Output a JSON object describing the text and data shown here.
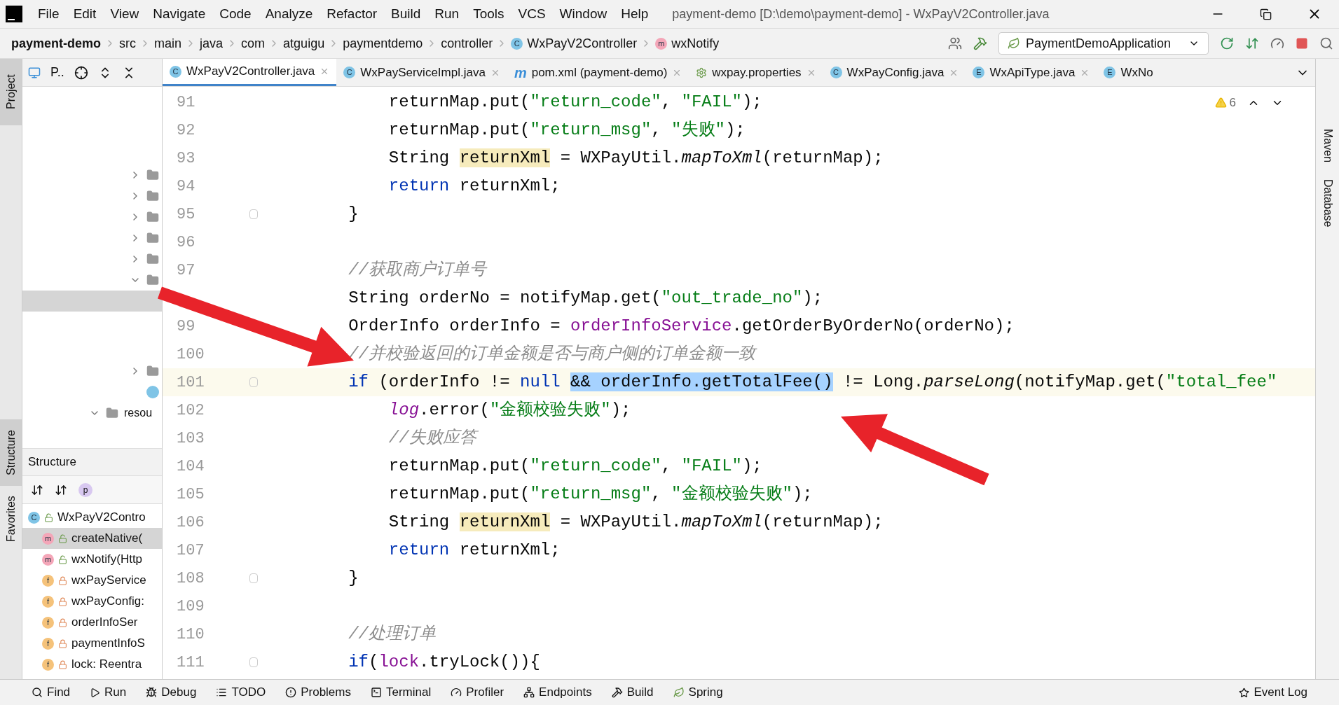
{
  "menu": [
    "File",
    "Edit",
    "View",
    "Navigate",
    "Code",
    "Analyze",
    "Refactor",
    "Build",
    "Run",
    "Tools",
    "VCS",
    "Window",
    "Help"
  ],
  "window": {
    "title": "payment-demo [D:\\demo\\payment-demo] - WxPayV2Controller.java"
  },
  "breadcrumbs": [
    {
      "label": "payment-demo",
      "kind": "project"
    },
    {
      "label": "src",
      "kind": "folder"
    },
    {
      "label": "main",
      "kind": "folder"
    },
    {
      "label": "java",
      "kind": "folder"
    },
    {
      "label": "com",
      "kind": "folder"
    },
    {
      "label": "atguigu",
      "kind": "folder"
    },
    {
      "label": "paymentdemo",
      "kind": "folder"
    },
    {
      "label": "controller",
      "kind": "folder"
    },
    {
      "label": "WxPayV2Controller",
      "kind": "class",
      "badge": "C"
    },
    {
      "label": "wxNotify",
      "kind": "method",
      "badge": "m"
    }
  ],
  "run_config": {
    "label": "PaymentDemoApplication"
  },
  "project_panel": {
    "title": "P..",
    "tree": [
      {
        "kind": "folder",
        "expanded": false,
        "selected": false
      },
      {
        "kind": "folder",
        "expanded": false,
        "selected": false
      },
      {
        "kind": "folder",
        "expanded": false,
        "selected": false
      },
      {
        "kind": "folder",
        "expanded": false,
        "selected": false
      },
      {
        "kind": "folder",
        "expanded": false,
        "selected": false
      },
      {
        "kind": "folder",
        "expanded": true,
        "selected": false
      },
      {
        "kind": "blank",
        "selected": true
      },
      {
        "kind": "folder",
        "expanded": false,
        "selected": false
      },
      {
        "kind": "class",
        "selected": false
      },
      {
        "kind": "folder",
        "expanded": true,
        "selected": false,
        "label": "resou"
      }
    ]
  },
  "structure_panel": {
    "title": "Structure",
    "filter_badge": "p",
    "items": [
      {
        "badge": "C",
        "label": "WxPayV2Contro",
        "kind": "class",
        "selected": false
      },
      {
        "badge": "m",
        "label": "createNative(",
        "kind": "method",
        "selected": true
      },
      {
        "badge": "m",
        "label": "wxNotify(Http",
        "kind": "method",
        "selected": false
      },
      {
        "badge": "f",
        "label": "wxPayService",
        "kind": "field",
        "selected": false
      },
      {
        "badge": "f",
        "label": "wxPayConfig:",
        "kind": "field",
        "selected": false
      },
      {
        "badge": "f",
        "label": "orderInfoSer",
        "kind": "field",
        "selected": false
      },
      {
        "badge": "f",
        "label": "paymentInfoS",
        "kind": "field",
        "selected": false
      },
      {
        "badge": "f",
        "label": "lock: Reentra",
        "kind": "field",
        "selected": false
      }
    ]
  },
  "side_tabs_left": [
    {
      "label": "Project",
      "selected": true
    },
    {
      "label": "Structure",
      "selected": true
    },
    {
      "label": "Favorites",
      "selected": false
    }
  ],
  "side_tabs_right": [
    "Maven",
    "Database"
  ],
  "tabs": [
    {
      "label": "WxPayV2Controller.java",
      "badge": "C",
      "kind": "class",
      "selected": true
    },
    {
      "label": "WxPayServiceImpl.java",
      "badge": "C",
      "kind": "class",
      "selected": false
    },
    {
      "label": "pom.xml (payment-demo)",
      "badge": "m",
      "kind": "maven",
      "selected": false
    },
    {
      "label": "wxpay.properties",
      "kind": "properties",
      "selected": false
    },
    {
      "label": "WxPayConfig.java",
      "badge": "C",
      "kind": "class",
      "selected": false
    },
    {
      "label": "WxApiType.java",
      "badge": "E",
      "kind": "enum",
      "selected": false
    },
    {
      "label": "WxNo",
      "badge": "E",
      "kind": "enum",
      "selected": false
    }
  ],
  "inspections": {
    "warnings": "6"
  },
  "code": [
    {
      "number": "91",
      "tokens": [
        {
          "kind": "plain",
          "text": "            returnMap.put("
        },
        {
          "kind": "string",
          "text": "\"return_code\""
        },
        {
          "kind": "plain",
          "text": ", "
        },
        {
          "kind": "string",
          "text": "\"FAIL\""
        },
        {
          "kind": "plain",
          "text": ");"
        }
      ]
    },
    {
      "number": "92",
      "tokens": [
        {
          "kind": "plain",
          "text": "            returnMap.put("
        },
        {
          "kind": "string",
          "text": "\"return_msg\""
        },
        {
          "kind": "plain",
          "text": ", "
        },
        {
          "kind": "string",
          "text": "\"失败\""
        },
        {
          "kind": "plain",
          "text": ");"
        }
      ]
    },
    {
      "number": "93",
      "tokens": [
        {
          "kind": "plain",
          "text": "            String "
        },
        {
          "kind": "usage",
          "text": "returnXml"
        },
        {
          "kind": "plain",
          "text": " = WXPayUtil."
        },
        {
          "kind": "static",
          "text": "mapToXml"
        },
        {
          "kind": "plain",
          "text": "(returnMap);"
        }
      ]
    },
    {
      "number": "94",
      "tokens": [
        {
          "kind": "keyword",
          "text": "            return"
        },
        {
          "kind": "plain",
          "text": " returnXml;"
        }
      ]
    },
    {
      "number": "95",
      "fold": true,
      "tokens": [
        {
          "kind": "plain",
          "text": "        }"
        }
      ]
    },
    {
      "number": "96"
    },
    {
      "number": "97",
      "tokens": [
        {
          "kind": "comment",
          "text": "        //获取商户订单号"
        }
      ]
    },
    {
      "tokens": [
        {
          "kind": "plain",
          "text": "        String orderNo = notifyMap.get("
        },
        {
          "kind": "string",
          "text": "\"out_trade_no\""
        },
        {
          "kind": "plain",
          "text": ");"
        }
      ]
    },
    {
      "number": "99",
      "tokens": [
        {
          "kind": "plain",
          "text": "        OrderInfo orderInfo = "
        },
        {
          "kind": "field",
          "text": "orderInfoService"
        },
        {
          "kind": "plain",
          "text": ".getOrderByOrderNo(orderNo);"
        }
      ]
    },
    {
      "number": "100",
      "tokens": [
        {
          "kind": "comment",
          "text": "        //并校验返回的订单金额是否与商户侧的订单金额一致"
        }
      ]
    },
    {
      "number": "101",
      "fold": true,
      "current": true,
      "tokens": [
        {
          "kind": "keyword",
          "text": "        if"
        },
        {
          "kind": "plain",
          "text": " (orderInfo != "
        },
        {
          "kind": "keyword",
          "text": "null "
        },
        {
          "kind": "selection",
          "text": "&& orderInfo.getTotalFee()"
        },
        {
          "kind": "plain",
          "text": " != Long."
        },
        {
          "kind": "static",
          "text": "parseLong"
        },
        {
          "kind": "plain",
          "text": "(notifyMap.get("
        },
        {
          "kind": "string",
          "text": "\"total_fee\""
        }
      ]
    },
    {
      "number": "102",
      "tokens": [
        {
          "kind": "staticfield",
          "text": "            log"
        },
        {
          "kind": "plain",
          "text": ".error("
        },
        {
          "kind": "string",
          "text": "\"金额校验失败\""
        },
        {
          "kind": "plain",
          "text": ");"
        }
      ]
    },
    {
      "number": "103",
      "tokens": [
        {
          "kind": "comment",
          "text": "            //失败应答"
        }
      ]
    },
    {
      "number": "104",
      "tokens": [
        {
          "kind": "plain",
          "text": "            returnMap.put("
        },
        {
          "kind": "string",
          "text": "\"return_code\""
        },
        {
          "kind": "plain",
          "text": ", "
        },
        {
          "kind": "string",
          "text": "\"FAIL\""
        },
        {
          "kind": "plain",
          "text": ");"
        }
      ]
    },
    {
      "number": "105",
      "tokens": [
        {
          "kind": "plain",
          "text": "            returnMap.put("
        },
        {
          "kind": "string",
          "text": "\"return_msg\""
        },
        {
          "kind": "plain",
          "text": ", "
        },
        {
          "kind": "string",
          "text": "\"金额校验失败\""
        },
        {
          "kind": "plain",
          "text": ");"
        }
      ]
    },
    {
      "number": "106",
      "tokens": [
        {
          "kind": "plain",
          "text": "            String "
        },
        {
          "kind": "usage",
          "text": "returnXml"
        },
        {
          "kind": "plain",
          "text": " = WXPayUtil."
        },
        {
          "kind": "static",
          "text": "mapToXml"
        },
        {
          "kind": "plain",
          "text": "(returnMap);"
        }
      ]
    },
    {
      "number": "107",
      "tokens": [
        {
          "kind": "keyword",
          "text": "            return"
        },
        {
          "kind": "plain",
          "text": " returnXml;"
        }
      ]
    },
    {
      "number": "108",
      "fold": true,
      "tokens": [
        {
          "kind": "plain",
          "text": "        }"
        }
      ]
    },
    {
      "number": "109"
    },
    {
      "number": "110",
      "tokens": [
        {
          "kind": "comment",
          "text": "        //处理订单"
        }
      ]
    },
    {
      "number": "111",
      "fold": true,
      "tokens": [
        {
          "kind": "keyword",
          "text": "        if"
        },
        {
          "kind": "plain",
          "text": "("
        },
        {
          "kind": "field",
          "text": "lock"
        },
        {
          "kind": "plain",
          "text": ".tryLock()){"
        }
      ]
    }
  ],
  "tool_windows": [
    "Find",
    "Run",
    "Debug",
    "TODO",
    "Problems",
    "Terminal",
    "Profiler",
    "Endpoints",
    "Build",
    "Spring"
  ],
  "event_log": "Event Log"
}
